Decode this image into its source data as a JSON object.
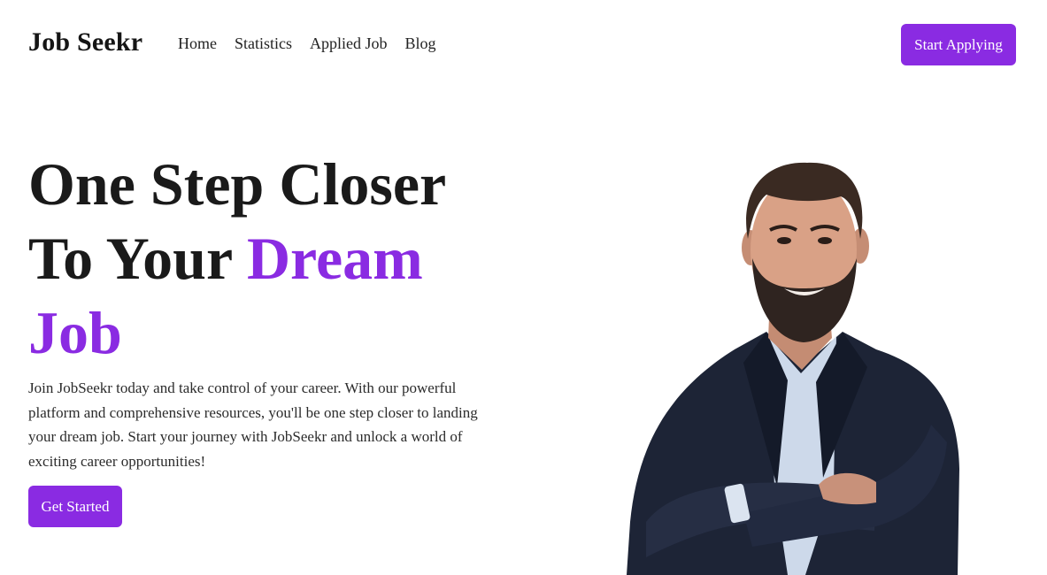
{
  "header": {
    "logo": "Job Seekr",
    "nav": [
      "Home",
      "Statistics",
      "Applied Job",
      "Blog"
    ],
    "cta": "Start Applying"
  },
  "hero": {
    "title_line1": "One Step Closer",
    "title_line2_plain": "To Your ",
    "title_line2_accent": "Dream",
    "title_line3_accent": "Job",
    "description": "Join JobSeekr today and take control of your career. With our powerful platform and comprehensive resources, you'll be one step closer to landing your dream job. Start your journey with JobSeekr and unlock a world of exciting career opportunities!",
    "cta": "Get Started"
  },
  "colors": {
    "accent": "#8a2be2",
    "text": "#1a1a1a",
    "background": "#ffffff"
  }
}
